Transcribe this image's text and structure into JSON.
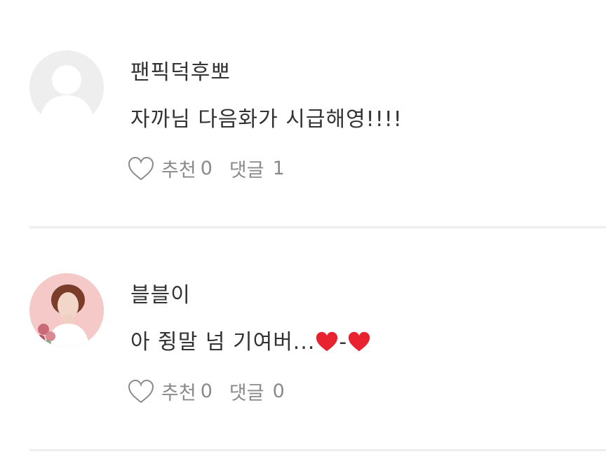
{
  "comments": [
    {
      "author": "팬픽덕후뽀",
      "avatar": "default-avatar-icon",
      "text": "자까님 다음화가 시급해영!!!!",
      "emojis": [],
      "like_label": "추천",
      "like_count": "0",
      "reply_label": "댓글",
      "reply_count": "1"
    },
    {
      "author": "블블이",
      "avatar": "user-photo",
      "text_before": "아 쥥말 넘 기여버...",
      "text_sep": "-",
      "emojis": [
        "red-heart",
        "red-heart"
      ],
      "like_label": "추천",
      "like_count": "0",
      "reply_label": "댓글",
      "reply_count": "0"
    }
  ],
  "colors": {
    "text": "#333333",
    "muted": "#8a8a8a",
    "divider": "#eeeeee",
    "heart": "#e8232f"
  }
}
